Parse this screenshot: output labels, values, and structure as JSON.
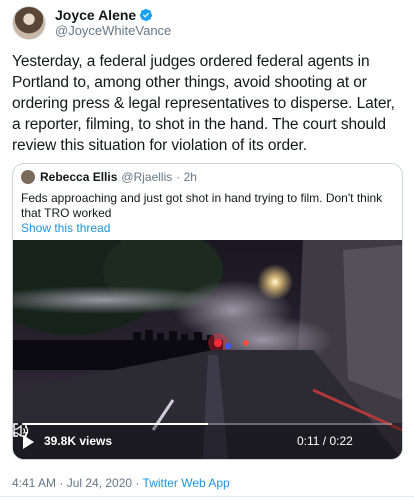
{
  "author": {
    "display_name": "Joyce Alene",
    "handle": "@JoyceWhiteVance"
  },
  "tweet_text": "Yesterday, a federal judges ordered federal agents in Portland to, among other things, avoid shooting at or ordering press & legal representatives to disperse. Later, a reporter, filming, to shot in the hand. The court should review this situation for violation of its order.",
  "quoted": {
    "display_name": "Rebecca Ellis",
    "handle": "@Rjaellis",
    "age": "· 2h",
    "text": "Feds approaching and just got shot in hand trying to film. Don't think that  TRO worked",
    "show_thread": "Show this thread",
    "video": {
      "views": "39.8K views",
      "time": "0:11 / 0:22",
      "progress_fraction": 0.5
    }
  },
  "meta": {
    "timestamp": "4:41 AM · Jul 24, 2020 · ",
    "source": "Twitter Web App"
  },
  "colors": {
    "link": "#1b95e0",
    "verified": "#1da1f2",
    "secondary_text": "#657786"
  }
}
